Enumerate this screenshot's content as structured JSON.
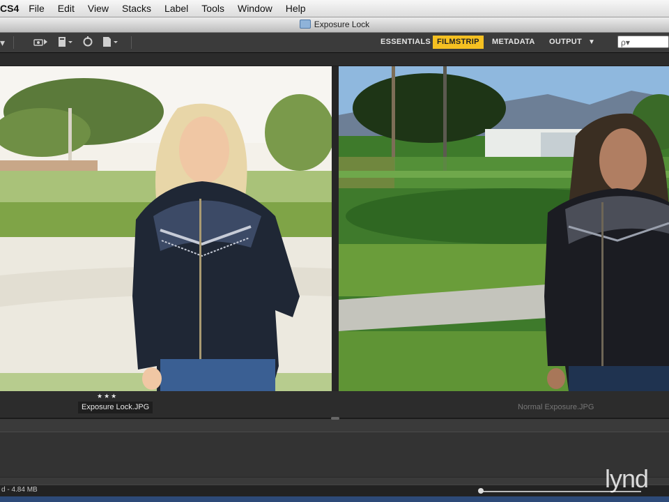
{
  "menubar": {
    "app_name": "CS4",
    "items": [
      "File",
      "Edit",
      "View",
      "Stacks",
      "Label",
      "Tools",
      "Window",
      "Help"
    ]
  },
  "window": {
    "title": "Exposure Lock"
  },
  "toolbar": {
    "icons": [
      "camera-import-icon",
      "paste-icon",
      "rotate-icon",
      "output-icon"
    ]
  },
  "workspaces": {
    "items": [
      "ESSENTIALS",
      "FILMSTRIP",
      "METADATA",
      "OUTPUT"
    ],
    "active": "FILMSTRIP",
    "active_color": "#f5c021"
  },
  "search": {
    "placeholder": "ρ▾"
  },
  "preview": {
    "left_filename": "Exposure Lock.JPG",
    "left_rating": "★★★",
    "right_filename": "Normal Exposure.JPG"
  },
  "status": {
    "text": "d - 4.84 MB"
  },
  "watermark": "lynd"
}
